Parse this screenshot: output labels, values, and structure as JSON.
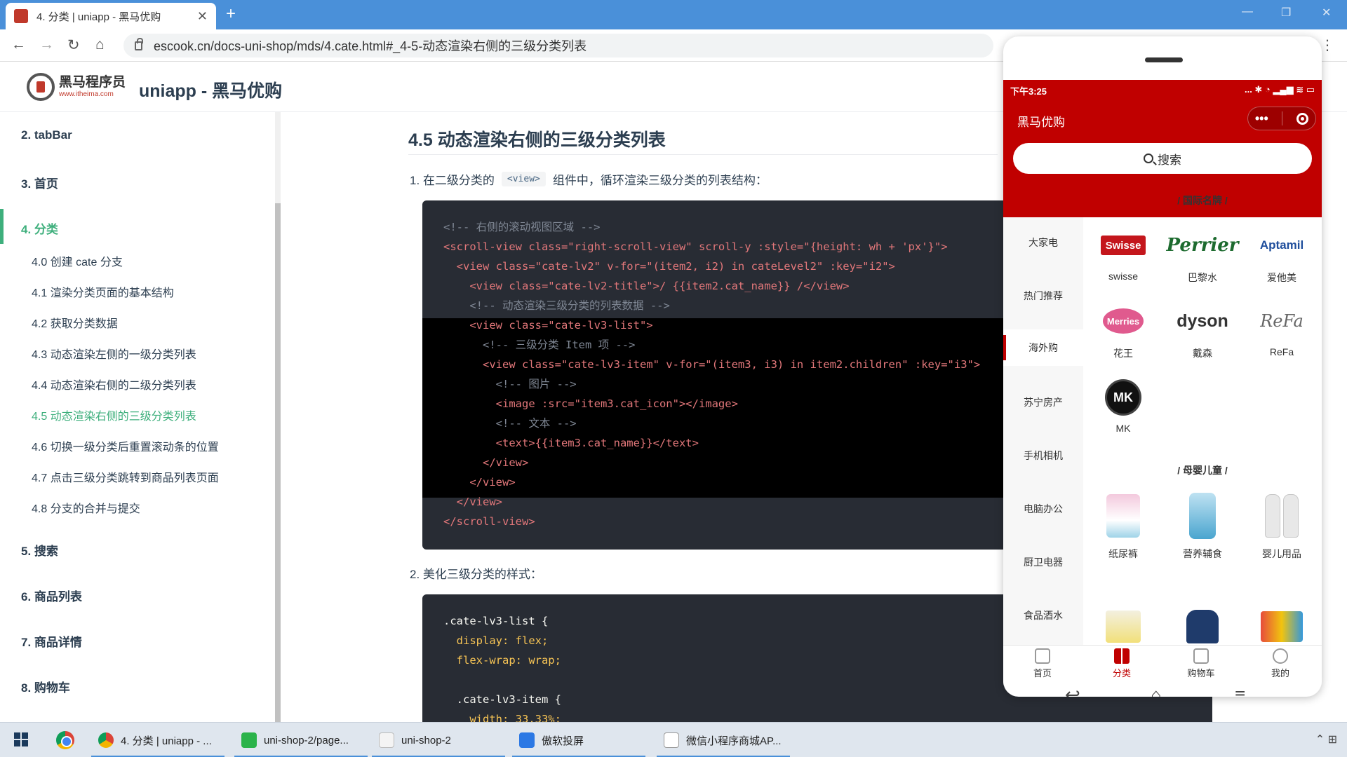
{
  "browser": {
    "tab_title": "4. 分类 | uniapp - 黑马优购",
    "new_tab": "+",
    "url": "escook.cn/docs-uni-shop/mds/4.cate.html#_4-5-动态渲染右侧的三级分类列表"
  },
  "site": {
    "logo_text": "黑马程序员",
    "logo_sub": "www.itheima.com",
    "title": "uniapp - 黑马优购"
  },
  "sidebar": {
    "sections": [
      {
        "label": "2. tabBar"
      },
      {
        "label": "3. 首页"
      },
      {
        "label": "4. 分类"
      },
      {
        "label": "5. 搜索"
      },
      {
        "label": "6. 商品列表"
      },
      {
        "label": "7. 商品详情"
      },
      {
        "label": "8. 购物车"
      }
    ],
    "subitems": [
      {
        "label": "4.0 创建 cate 分支"
      },
      {
        "label": "4.1 渲染分类页面的基本结构"
      },
      {
        "label": "4.2 获取分类数据"
      },
      {
        "label": "4.3 动态渲染左侧的一级分类列表"
      },
      {
        "label": "4.4 动态渲染右侧的二级分类列表"
      },
      {
        "label": "4.5 动态渲染右侧的三级分类列表"
      },
      {
        "label": "4.6 切换一级分类后重置滚动条的位置"
      },
      {
        "label": "4.7 点击三级分类跳转到商品列表页面"
      },
      {
        "label": "4.8 分支的合并与提交"
      }
    ]
  },
  "content": {
    "heading": "4.5 动态渲染右侧的三级分类列表",
    "step1_pre": "1. 在二级分类的",
    "step1_code": "<view>",
    "step1_post": "组件中，循环渲染三级分类的列表结构：",
    "step2": "2. 美化三级分类的样式：",
    "code1": [
      "<!-- 右侧的滚动视图区域 -->",
      "<scroll-view class=\"right-scroll-view\" scroll-y :style=\"{height: wh + 'px'}\">",
      "  <view class=\"cate-lv2\" v-for=\"(item2, i2) in cateLevel2\" :key=\"i2\">",
      "    <view class=\"cate-lv2-title\">/ {{item2.cat_name}} /</view>",
      "    <!-- 动态渲染三级分类的列表数据 -->",
      "    <view class=\"cate-lv3-list\">",
      "      <!-- 三级分类 Item 项 -->",
      "      <view class=\"cate-lv3-item\" v-for=\"(item3, i3) in item2.children\" :key=\"i3\">",
      "        <!-- 图片 -->",
      "        <image :src=\"item3.cat_icon\"></image>",
      "        <!-- 文本 -->",
      "        <text>{{item3.cat_name}}</text>",
      "      </view>",
      "    </view>",
      "  </view>",
      "</scroll-view>"
    ],
    "code2": [
      ".cate-lv3-list {",
      "  display: flex;",
      "  flex-wrap: wrap;",
      "",
      "  .cate-lv3-item {",
      "    width: 33.33%;"
    ]
  },
  "phone": {
    "time": "下午3:25",
    "status_icons": "... ✱ ◔ ▂▄▆ ≋ ▭",
    "app_title": "黑马优购",
    "capsule_more": "•••",
    "search_label": "搜索",
    "left_nav": [
      "大家电",
      "热门推荐",
      "海外购",
      "苏宁房产",
      "手机相机",
      "电脑办公",
      "厨卫电器",
      "食品酒水"
    ],
    "lv2_titles": [
      "/ 国际名牌 /",
      "/ 母婴儿童 /"
    ],
    "lv3_brands": [
      {
        "label": "swisse",
        "icon": "swisse-logo",
        "mark": "Swisse"
      },
      {
        "label": "巴黎水",
        "icon": "perrier-logo",
        "mark": "Perrier"
      },
      {
        "label": "爱他美",
        "icon": "aptamil-logo",
        "mark": "Aptamil"
      },
      {
        "label": "花王",
        "icon": "merries-logo",
        "mark": "Merries"
      },
      {
        "label": "戴森",
        "icon": "dyson-logo",
        "mark": "dyson"
      },
      {
        "label": "ReFa",
        "icon": "refa-logo",
        "mark": "ReFa"
      },
      {
        "label": "MK",
        "icon": "mk-logo",
        "mark": "MK"
      }
    ],
    "lv3_baby": [
      {
        "label": "纸尿裤",
        "icon": "diaper-image"
      },
      {
        "label": "营养辅食",
        "icon": "formula-image"
      },
      {
        "label": "婴儿用品",
        "icon": "bottle-image"
      }
    ],
    "tabs": [
      {
        "label": "首页",
        "icon": "home-icon"
      },
      {
        "label": "分类",
        "icon": "category-icon"
      },
      {
        "label": "购物车",
        "icon": "cart-icon"
      },
      {
        "label": "我的",
        "icon": "user-icon"
      }
    ]
  },
  "taskbar": {
    "apps": [
      {
        "label": "4. 分类 | uniapp - ..."
      },
      {
        "label": "uni-shop-2/page..."
      },
      {
        "label": "uni-shop-2"
      },
      {
        "label": "傲软投屏"
      },
      {
        "label": "微信小程序商城AP..."
      }
    ]
  },
  "colors": {
    "accent": "#3eaf7c",
    "phone_red": "#c00000",
    "code_bg": "#282c34",
    "chrome_blue": "#4a90d9"
  }
}
